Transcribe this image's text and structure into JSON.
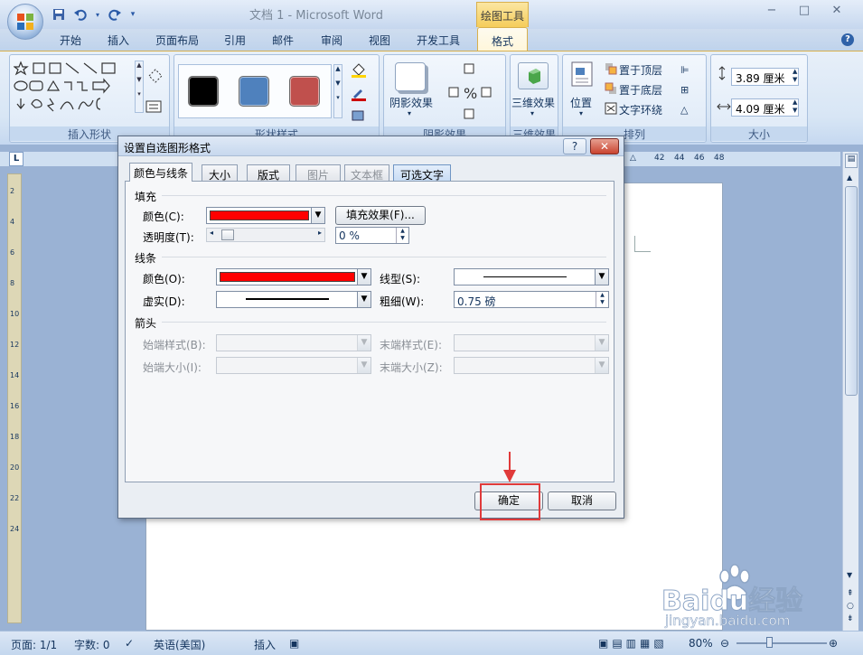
{
  "window": {
    "doc_title": "文档 1 - Microsoft Word",
    "contextual_tab": "绘图工具",
    "controls": [
      "−",
      "□",
      "✕"
    ]
  },
  "tabs": [
    "开始",
    "插入",
    "页面布局",
    "引用",
    "邮件",
    "审阅",
    "视图",
    "开发工具"
  ],
  "active_tab": "格式",
  "ribbon": {
    "groups": {
      "insert_shapes": "插入形状",
      "shape_styles": "形状样式",
      "shadow_effects": "阴影效果",
      "three_d": "三维效果",
      "arrange": "排列",
      "size": "大小"
    },
    "shadow_button": "阴影效果",
    "three_d_button": "三维效果",
    "position_button": "位置",
    "bring_to_front": "置于顶层",
    "send_to_back": "置于底层",
    "text_wrap": "文字环绕",
    "height_value": "3.89 厘米",
    "width_value": "4.09 厘米",
    "style_colors": [
      "#000000",
      "#4f81bd",
      "#c0504d"
    ]
  },
  "hruler_numbers": [
    "42",
    "44",
    "46",
    "48"
  ],
  "vruler_numbers": [
    "2",
    "4",
    "6",
    "8",
    "10",
    "12",
    "14",
    "16",
    "18",
    "20",
    "22",
    "24"
  ],
  "statusbar": {
    "page": "页面: 1/1",
    "words": "字数: 0",
    "language": "英语(美国)",
    "mode": "插入",
    "zoom": "80%"
  },
  "watermark": {
    "brand": "Baidu经验",
    "url": "jingyan.baidu.com"
  },
  "dialog": {
    "title": "设置自选图形格式",
    "help": "?",
    "close": "✕",
    "tabs": [
      "颜色与线条",
      "大小",
      "版式",
      "图片",
      "文本框",
      "可选文字"
    ],
    "fill_section": "填充",
    "fill_color_label": "颜色(C):",
    "fill_color": "#ff0000",
    "fill_effects_button": "填充效果(F)...",
    "transparency_label": "透明度(T):",
    "transparency_value": "0 %",
    "line_section": "线条",
    "line_color_label": "颜色(O):",
    "line_color": "#ff0000",
    "line_style_label": "线型(S):",
    "dash_label": "虚实(D):",
    "weight_label": "粗细(W):",
    "weight_value": "0.75 磅",
    "arrow_section": "箭头",
    "begin_style_label": "始端样式(B):",
    "end_style_label": "末端样式(E):",
    "begin_size_label": "始端大小(I):",
    "end_size_label": "末端大小(Z):",
    "ok_button": "确定",
    "cancel_button": "取消"
  }
}
